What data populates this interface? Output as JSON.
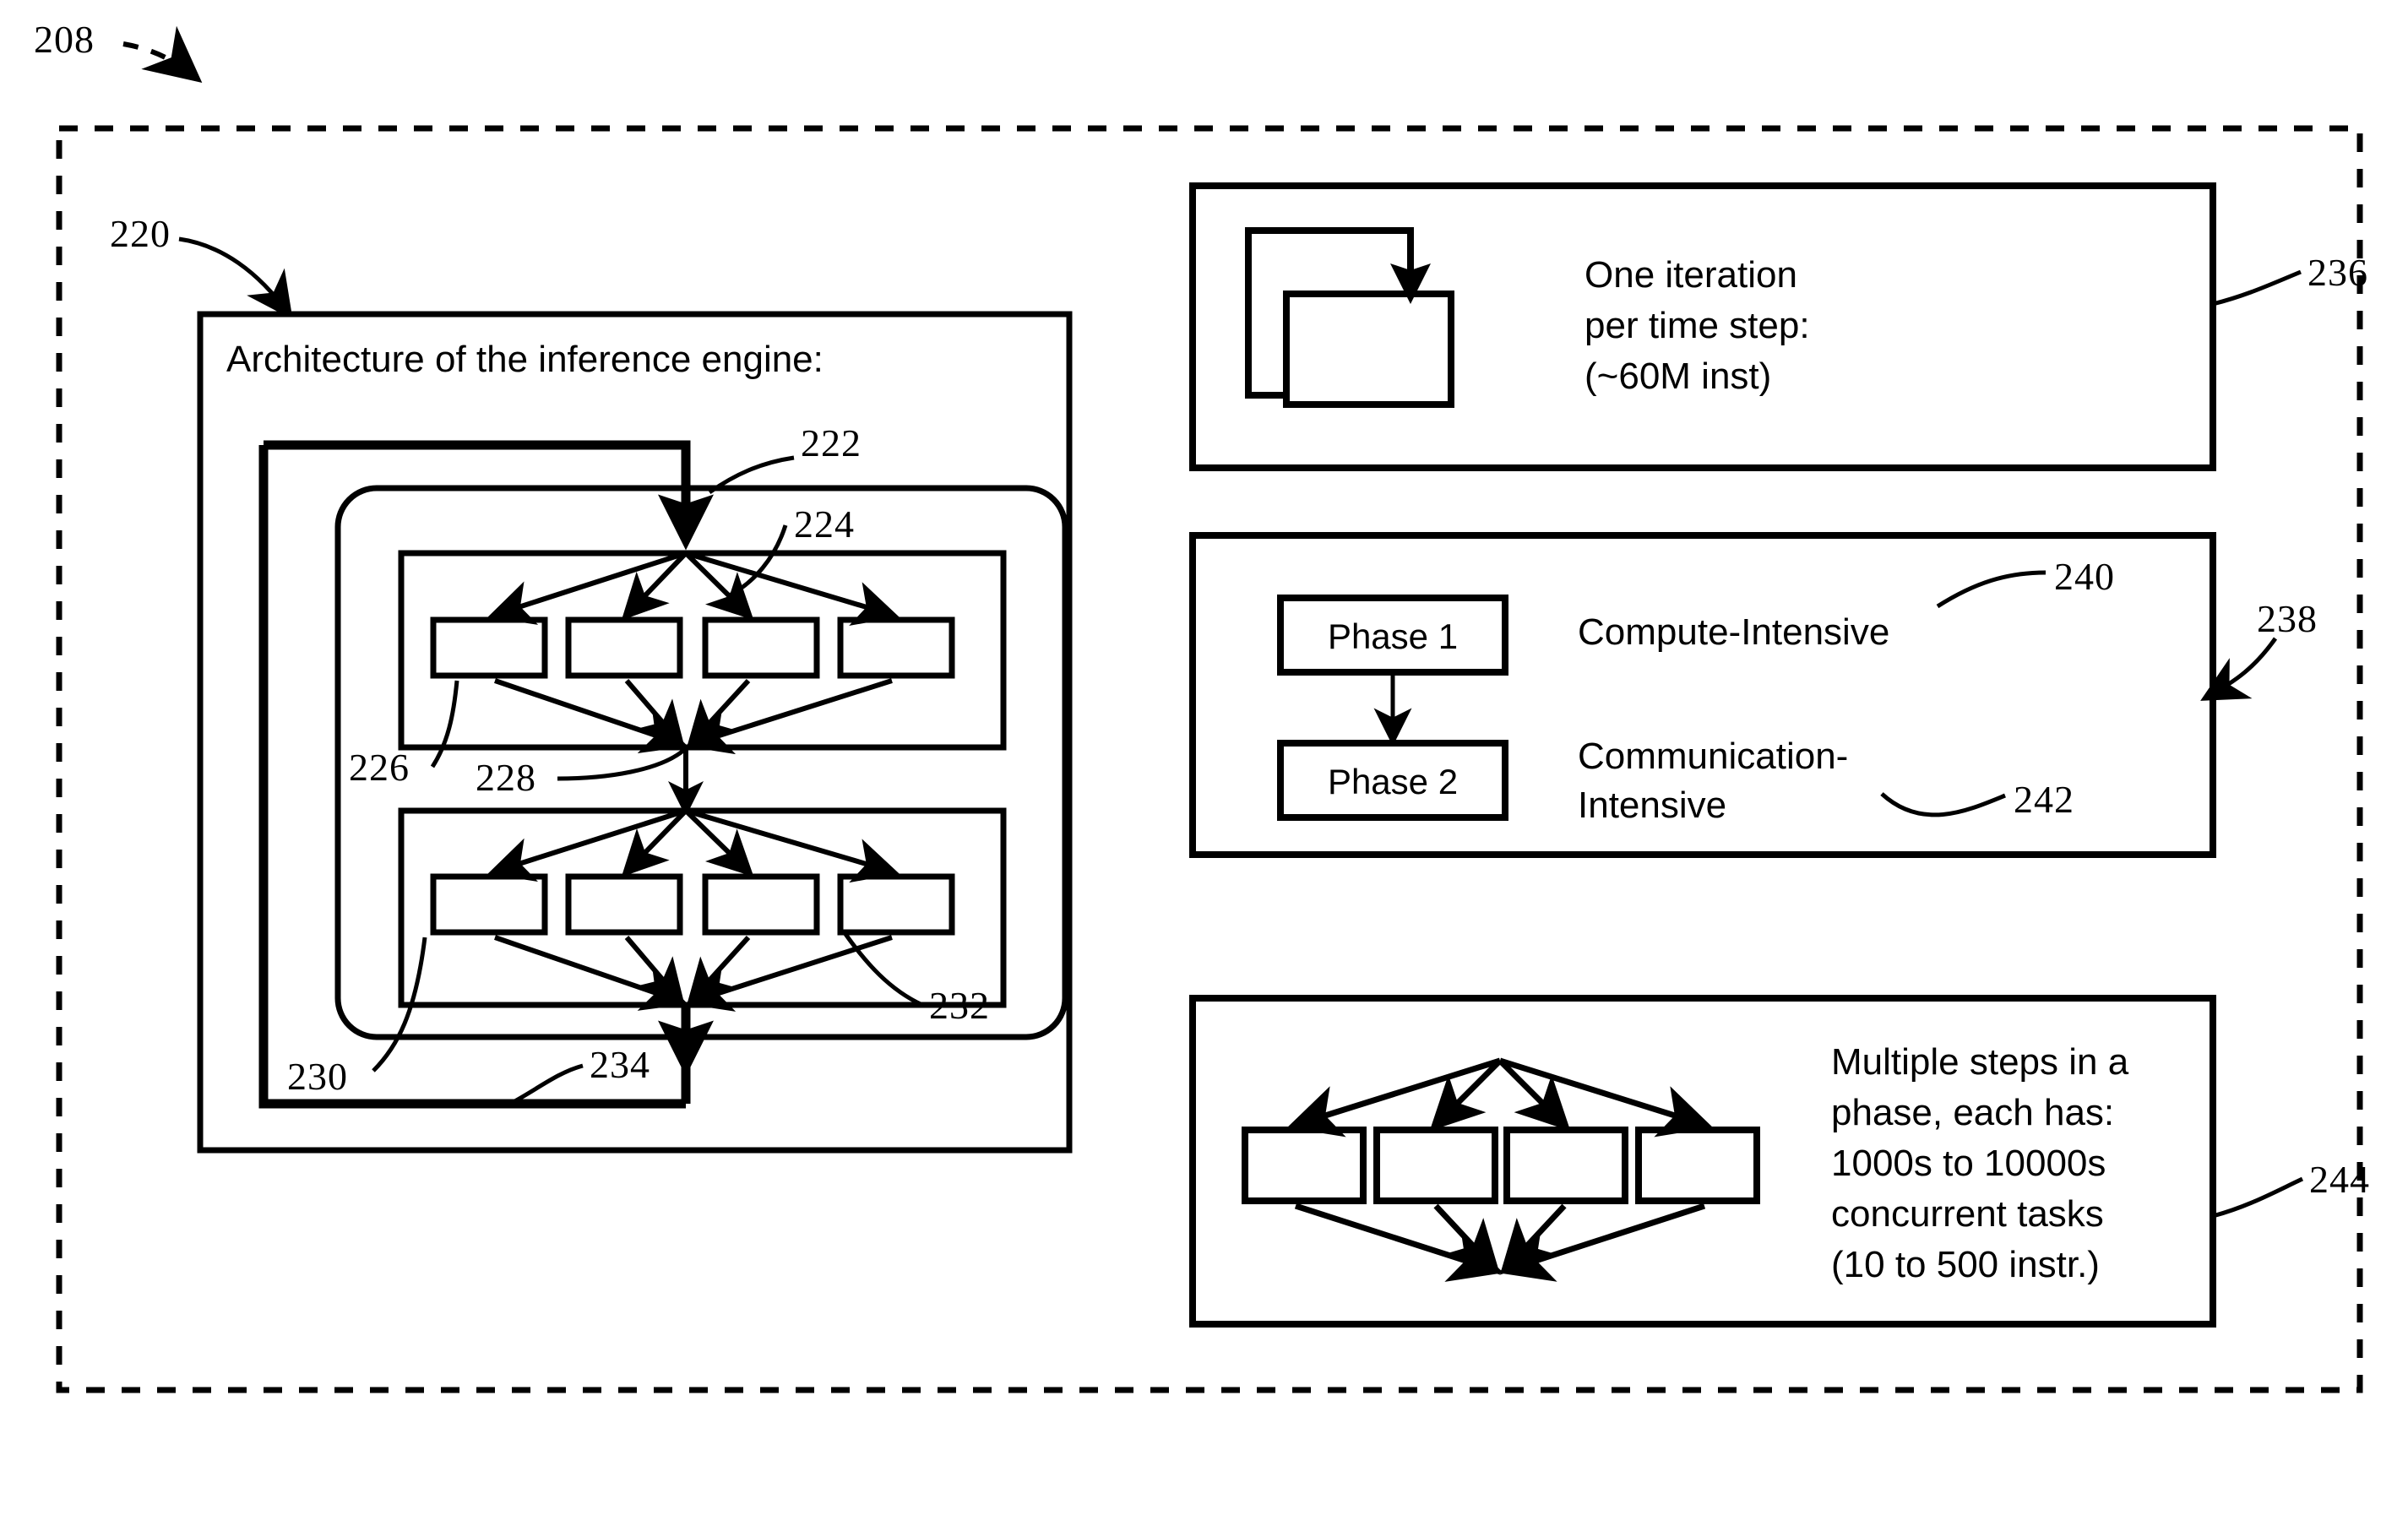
{
  "figure": {
    "outer_label": "208",
    "left_panel": {
      "label": "220",
      "title": "Architecture of the inference engine:",
      "refs": {
        "feedback_top": "222",
        "fanout_upper": "224",
        "unit_upper": "226",
        "join_upper": "228",
        "unit_lower": "230",
        "fanout_lower": "232",
        "feedback_bottom": "234"
      },
      "upper_group_boxes": [
        "",
        "",
        "",
        ""
      ],
      "lower_group_boxes": [
        "",
        "",
        "",
        ""
      ]
    },
    "right_panels": [
      {
        "label": "236",
        "icon": "loop-back-icon",
        "lines": [
          "One iteration",
          "per time step:",
          "(~60M inst)"
        ]
      },
      {
        "label": "238",
        "icon": "phase-sequence-icon",
        "phase_boxes": [
          {
            "name": "Phase 1"
          },
          {
            "name": "Phase 2"
          }
        ],
        "annotations": [
          {
            "text": "Compute-Intensive",
            "label": "240"
          },
          {
            "text_lines": [
              "Communication-",
              "Intensive"
            ],
            "label": "242"
          }
        ]
      },
      {
        "label": "244",
        "icon": "fanout-fanin-icon",
        "lines": [
          "Multiple steps in a",
          "phase, each has:",
          "1000s to 10000s",
          "concurrent tasks",
          "(10 to 500 instr.)"
        ]
      }
    ]
  },
  "colors": {
    "ink": "#000000",
    "paper": "#ffffff"
  }
}
